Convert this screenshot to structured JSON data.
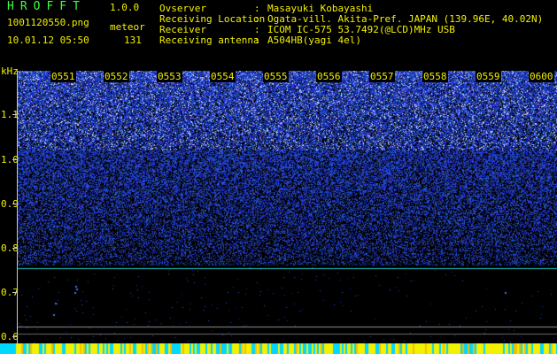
{
  "header": {
    "app_title": "HROFFT",
    "app_version": "1.0.0",
    "filename": "1001120550.png",
    "obs_type": "meteor",
    "datetime": "10.01.12 05:50",
    "count": "131",
    "observer_label": "Ovserver",
    "observer_value": "Masayuki Kobayashi",
    "location_label": "Receiving Location",
    "location_value": "Ogata-vill. Akita-Pref. JAPAN (139.96E, 40.02N)",
    "receiver_label": "Receiver",
    "receiver_value": "ICOM IC-575 53.7492(@LCD)MHz USB",
    "antenna_label": "Receiving antenna",
    "antenna_value": "A504HB(yagi 4el)",
    "separator": ":"
  },
  "plot": {
    "unit": "kHz",
    "y_ticks": [
      "1.1",
      "1.0",
      "0.9",
      "0.8",
      "0.7",
      "0.6"
    ],
    "x_ticks": [
      "0551",
      "0552",
      "0553",
      "0554",
      "0555",
      "0556",
      "0557",
      "0558",
      "0559",
      "0600"
    ]
  },
  "colors": {
    "background": "#000000",
    "label_yellow": "#f3f000",
    "title_green": "#3fff3f",
    "noise_blue": "#2a3cff",
    "cyan_line": "#20c8c8",
    "gray_line": "#a0a0a0"
  }
}
